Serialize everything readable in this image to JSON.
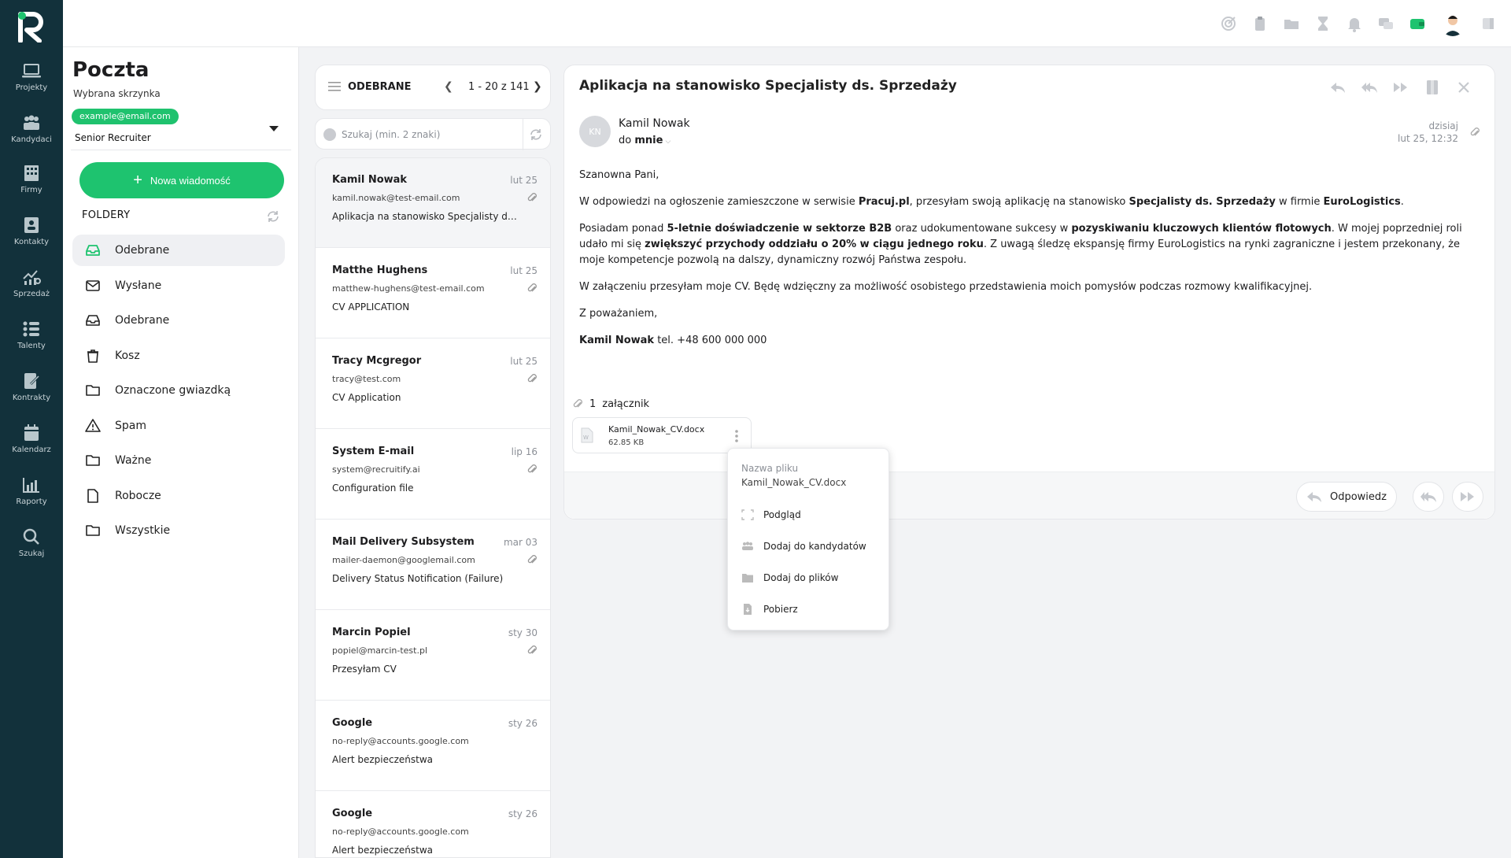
{
  "rail": {
    "items": [
      {
        "label": "Projekty",
        "icon": "laptop-icon"
      },
      {
        "label": "Kandydaci",
        "icon": "people-icon"
      },
      {
        "label": "Firmy",
        "icon": "building-icon"
      },
      {
        "label": "Kontakty",
        "icon": "contact-card-icon"
      },
      {
        "label": "Sprzedaż",
        "icon": "sales-chart-icon"
      },
      {
        "label": "Talenty",
        "icon": "talent-list-icon"
      },
      {
        "label": "Kontrakty",
        "icon": "contract-icon"
      },
      {
        "label": "Kalendarz",
        "icon": "calendar-icon"
      },
      {
        "label": "Raporty",
        "icon": "report-chart-icon"
      },
      {
        "label": "Szukaj",
        "icon": "search-icon"
      }
    ]
  },
  "sidebar": {
    "title": "Poczta",
    "mailbox_label": "Wybrana skrzynka",
    "email": "example@email.com",
    "role": "Senior Recruiter",
    "new_message": "Nowa wiadomość",
    "folders_label": "FOLDERY",
    "folders": [
      {
        "label": "Odebrane",
        "icon": "inbox-icon",
        "active": true
      },
      {
        "label": "Wysłane",
        "icon": "envelope-icon"
      },
      {
        "label": "Odebrane",
        "icon": "inbox-icon"
      },
      {
        "label": "Kosz",
        "icon": "trash-icon"
      },
      {
        "label": "Oznaczone gwiazdką",
        "icon": "folder-icon"
      },
      {
        "label": "Spam",
        "icon": "warning-icon"
      },
      {
        "label": "Ważne",
        "icon": "folder-icon"
      },
      {
        "label": "Robocze",
        "icon": "document-icon"
      },
      {
        "label": "Wszystkie",
        "icon": "folder-icon"
      }
    ]
  },
  "list": {
    "title": "ODEBRANE",
    "range": "1 - 20 z 141",
    "search_placeholder": "Szukaj (min. 2 znaki)",
    "messages": [
      {
        "from": "Kamil Nowak",
        "date": "lut 25",
        "address": "kamil.nowak@test-email.com",
        "subject": "Aplikacja na stanowisko Specjalisty ds. Sprzedaży",
        "selected": true
      },
      {
        "from": "Matthe Hughens",
        "date": "lut 25",
        "address": "matthew-hughens@test-email.com",
        "subject": "CV APPLICATION"
      },
      {
        "from": "Tracy Mcgregor",
        "date": "lut 25",
        "address": "tracy@test.com",
        "subject": "CV Application"
      },
      {
        "from": "System E-mail",
        "date": "lip 16",
        "address": "system@recruitify.ai",
        "subject": "Configuration file"
      },
      {
        "from": "Mail Delivery Subsystem",
        "date": "mar 03",
        "address": "mailer-daemon@googlemail.com",
        "subject": "Delivery Status Notification (Failure)"
      },
      {
        "from": "Marcin Popiel",
        "date": "sty 30",
        "address": "popiel@marcin-test.pl",
        "subject": "Przesyłam CV"
      },
      {
        "from": "Google",
        "date": "sty 26",
        "address": "no-reply@accounts.google.com",
        "subject": "Alert bezpieczeństwa"
      },
      {
        "from": "Google",
        "date": "sty 26",
        "address": "no-reply@accounts.google.com",
        "subject": "Alert bezpieczeństwa"
      }
    ]
  },
  "reader": {
    "subject": "Aplikacja na stanowisko Specjalisty ds. Sprzedaży",
    "avatar_initials": "KN",
    "from": "Kamil Nowak",
    "to_prefix": "do",
    "to": "mnie",
    "date_relative": "dzisiaj",
    "date_full": "lut 25, 12:32",
    "greeting": "Szanowna Pani,",
    "p1": {
      "a": "W odpowiedzi na ogłoszenie zamieszczone w serwisie ",
      "b": "Pracuj.pl",
      "c": ", przesyłam swoją aplikację na stanowisko ",
      "d": "Specjalisty ds. Sprzedaży",
      "e": " w firmie ",
      "f": "EuroLogistics",
      "g": "."
    },
    "p2": {
      "a": "Posiadam ponad ",
      "b": "5-letnie doświadczenie w sektorze B2B",
      "c": " oraz udokumentowane sukcesy w ",
      "d": "pozyskiwaniu kluczowych klientów flotowych",
      "e": ". W mojej poprzedniej roli udało mi się ",
      "f": "zwiększyć przychody oddziału o 20% w ciągu jednego roku",
      "g": ". Z uwagą śledzę ekspansję firmy EuroLogistics na rynki zagraniczne i jestem przekonany, że moje kompetencje pozwolą na dalszy, dynamiczny rozwój Państwa zespołu."
    },
    "p3": "W załączeniu przesyłam moje CV. Będę wdzięczny za możliwość osobistego przedstawienia moich pomysłów podczas rozmowy kwalifikacyjnej.",
    "closing": "Z poważaniem,",
    "signature_name": "Kamil Nowak",
    "signature_phone": " tel. +48 600 000 000",
    "attachments_count": "1",
    "attachments_label": "załącznik",
    "attachment": {
      "name": "Kamil_Nowak_CV.docx",
      "size": "62.85 KB"
    },
    "reply_label": "Odpowiedz"
  },
  "context_menu": {
    "caption": "Nazwa pliku",
    "file": "Kamil_Nowak_CV.docx",
    "items": [
      {
        "label": "Podgląd",
        "icon": "preview-icon"
      },
      {
        "label": "Dodaj do kandydatów",
        "icon": "people-icon"
      },
      {
        "label": "Dodaj do plików",
        "icon": "folder-icon"
      },
      {
        "label": "Pobierz",
        "icon": "download-file-icon"
      }
    ]
  },
  "colors": {
    "rail": "#12313b",
    "accent": "#1ec36f"
  }
}
